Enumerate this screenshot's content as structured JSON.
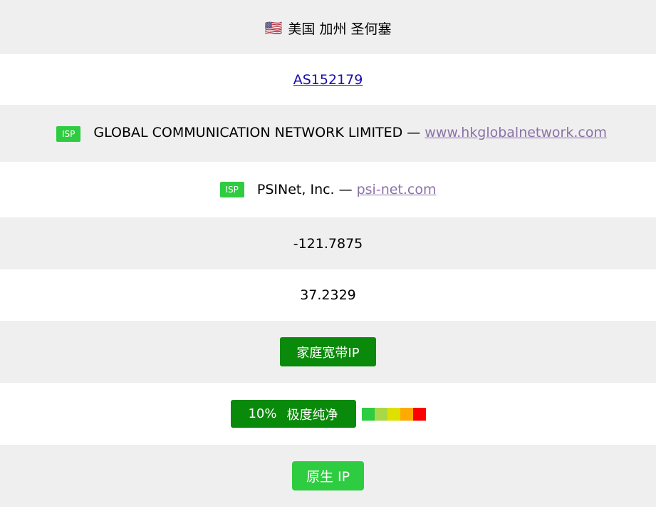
{
  "location": {
    "flag": "🇺🇸",
    "text": "美国 加州 圣何塞"
  },
  "asn": {
    "label": "AS152179"
  },
  "isp_rows": [
    {
      "badge": "ISP",
      "name": "GLOBAL COMMUNICATION NETWORK LIMITED",
      "separator": "—",
      "domain": "www.hkglobalnetwork.com"
    },
    {
      "badge": "ISP",
      "name": "PSINet, Inc.",
      "separator": "—",
      "domain": "psi-net.com"
    }
  ],
  "coordinates": {
    "longitude": "-121.7875",
    "latitude": "37.2329"
  },
  "ip_type": {
    "label": "家庭宽带IP"
  },
  "purity": {
    "percent_text": "10%",
    "label": "极度纯净",
    "value": 10,
    "bar_colors": [
      "#2ecc40",
      "#a8d84a",
      "#e0e000",
      "#ffaa00",
      "#ff0000"
    ]
  },
  "native": {
    "label": "原生 IP"
  },
  "colors": {
    "row_gray": "#efefef",
    "link_blue": "#1a0dab",
    "link_visited": "#8a72a8",
    "badge_green": "#2ecc40",
    "button_dark_green": "#0a8a0a"
  }
}
